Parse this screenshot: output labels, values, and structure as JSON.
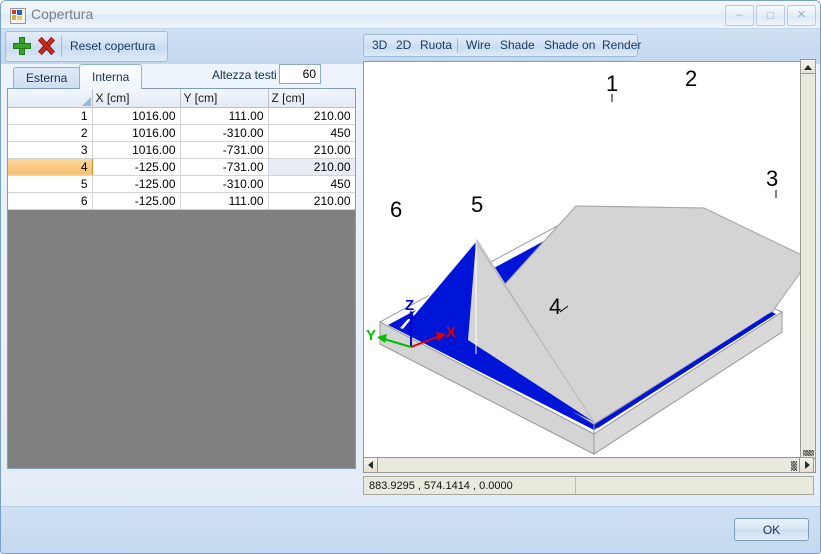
{
  "window": {
    "title": "Copertura",
    "icon": "app-icon",
    "minimize_label": "Minimize",
    "maximize_label": "Maximize",
    "close_label": "Close"
  },
  "toolbar": {
    "add_icon": "plus-icon",
    "delete_icon": "delete-x-icon",
    "reset_label": "Reset copertura",
    "altezza_label": "Altezza testi",
    "altezza_value": "60"
  },
  "tabs": [
    {
      "label": "Esterna",
      "active": false
    },
    {
      "label": "Interna",
      "active": true
    }
  ],
  "grid": {
    "columns": [
      "",
      "X [cm]",
      "Y [cm]",
      "Z [cm]"
    ],
    "highlight_column": "Z [cm]",
    "selected_row": 4,
    "rows": [
      {
        "idx": "1",
        "x": "1016.00",
        "y": "111.00",
        "z": "210.00"
      },
      {
        "idx": "2",
        "x": "1016.00",
        "y": "-310.00",
        "z": "450"
      },
      {
        "idx": "3",
        "x": "1016.00",
        "y": "-731.00",
        "z": "210.00"
      },
      {
        "idx": "4",
        "x": "-125.00",
        "y": "-731.00",
        "z": "210.00"
      },
      {
        "idx": "5",
        "x": "-125.00",
        "y": "-310.00",
        "z": "450"
      },
      {
        "idx": "6",
        "x": "-125.00",
        "y": "111.00",
        "z": "210.00"
      }
    ]
  },
  "view_toolbar": {
    "buttons": [
      "3D",
      "2D",
      "Ruota",
      "Wire",
      "Shade",
      "Shade on",
      "Render"
    ]
  },
  "viewport": {
    "vertex_labels": [
      "1",
      "2",
      "3",
      "4",
      "5",
      "6"
    ],
    "axes": {
      "x": "X",
      "y": "Y",
      "z": "Z",
      "x_color": "#e00000",
      "y_color": "#00c000",
      "z_color": "#0000d0"
    },
    "roof_color": "#d4d4d4",
    "floor_color": "#0015d8",
    "background": "#ffffff"
  },
  "status": {
    "coordinates": "883.9295 , 574.1414 , 0.0000",
    "second_panel": ""
  },
  "footer": {
    "ok_label": "OK"
  }
}
